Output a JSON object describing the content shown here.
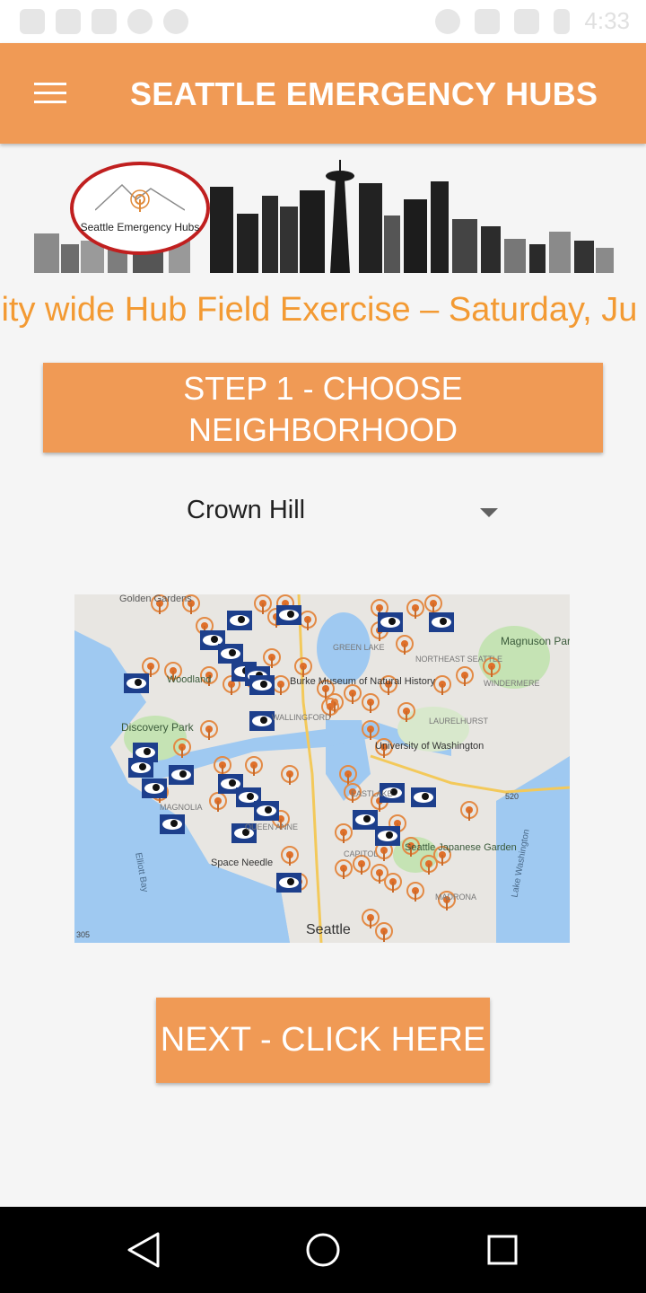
{
  "status_bar": {
    "time": "4:33"
  },
  "app_bar": {
    "title": "SEATTLE EMERGENCY HUBS",
    "menu_icon": "hamburger-menu-icon"
  },
  "banner": {
    "logo_text": "Seattle Emergency Hubs"
  },
  "marquee": {
    "text": "City wide Hub Field Exercise – Saturday, Ju"
  },
  "step": {
    "label": "STEP 1 - CHOOSE NEIGHBORHOOD"
  },
  "neighborhood": {
    "selected": "Crown Hill"
  },
  "map": {
    "labels": {
      "golden_gardens": "Golden Gardens",
      "magnuson": "Magnuson Park",
      "woodland": "Woodland",
      "burke": "Burke Museum of Natural History",
      "northeast_seattle": "NORTHEAST SEATTLE",
      "windermere": "WINDERMERE",
      "green_lake": "GREEN LAKE",
      "discovery": "Discovery Park",
      "university": "University of Washington",
      "laurelhurst": "LAURELHURST",
      "eastlake": "EASTLAKE",
      "queen_anne": "QUEEN ANNE",
      "space_needle": "Space Needle",
      "capitol": "CAPITOL",
      "japanese_garden": "Seattle Japanese Garden",
      "madrona": "MADRONA",
      "seattle": "Seattle",
      "elliott_bay": "Elliott Bay",
      "lake_washington": "Lake Washington",
      "hwy_520": "520",
      "hwy_305": "305",
      "wallingford": "WALLINGFORD",
      "magnolia": "MAGNOLIA"
    }
  },
  "next": {
    "label": "NEXT - CLICK HERE"
  },
  "colors": {
    "accent": "#f09a55",
    "marquee": "#f39a33"
  }
}
